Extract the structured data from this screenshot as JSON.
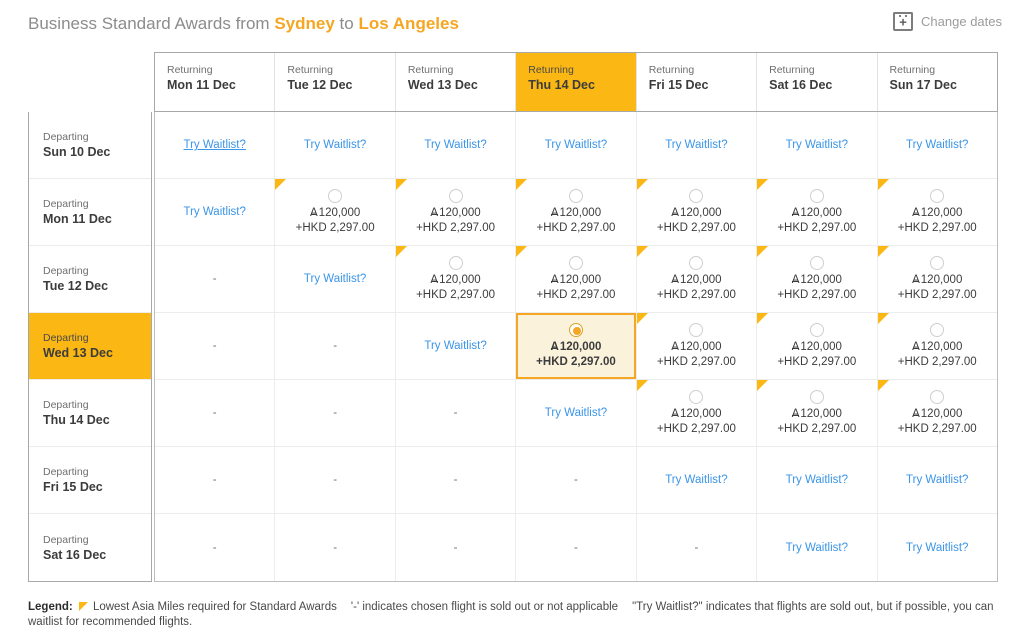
{
  "header": {
    "title_prefix": "Business Standard Awards from",
    "origin": "Sydney",
    "connector": "to",
    "destination": "Los Angeles",
    "change_dates_label": "Change dates",
    "calendar_icon": "calendar-plus-icon",
    "accent_color": "#f5a623",
    "highlight_color": "#fbb713"
  },
  "columns": {
    "label_prefix": "Returning",
    "dates": [
      "Mon 11 Dec",
      "Tue 12 Dec",
      "Wed 13 Dec",
      "Thu 14 Dec",
      "Fri 15 Dec",
      "Sat 16 Dec",
      "Sun 17 Dec"
    ],
    "selected_index": 3
  },
  "rows": {
    "label_prefix": "Departing",
    "dates": [
      "Sun 10 Dec",
      "Mon 11 Dec",
      "Tue 12 Dec",
      "Wed 13 Dec",
      "Thu 14 Dec",
      "Fri 15 Dec",
      "Sat 16 Dec"
    ],
    "selected_index": 3
  },
  "labels": {
    "waitlist": "Try Waitlist?",
    "dash": "-",
    "miles_symbol": "A",
    "miles_value": "120,000",
    "tax_value": "+HKD 2,297.00"
  },
  "cells": [
    [
      {
        "type": "waitlist",
        "hover": true
      },
      {
        "type": "waitlist"
      },
      {
        "type": "waitlist"
      },
      {
        "type": "waitlist"
      },
      {
        "type": "waitlist"
      },
      {
        "type": "waitlist"
      },
      {
        "type": "waitlist"
      }
    ],
    [
      {
        "type": "waitlist"
      },
      {
        "type": "price",
        "flag": true
      },
      {
        "type": "price",
        "flag": true
      },
      {
        "type": "price",
        "flag": true
      },
      {
        "type": "price",
        "flag": true
      },
      {
        "type": "price",
        "flag": true
      },
      {
        "type": "price",
        "flag": true
      }
    ],
    [
      {
        "type": "dash"
      },
      {
        "type": "waitlist"
      },
      {
        "type": "price",
        "flag": true
      },
      {
        "type": "price",
        "flag": true
      },
      {
        "type": "price",
        "flag": true
      },
      {
        "type": "price",
        "flag": true
      },
      {
        "type": "price",
        "flag": true
      }
    ],
    [
      {
        "type": "dash"
      },
      {
        "type": "dash"
      },
      {
        "type": "waitlist"
      },
      {
        "type": "price",
        "selected": true
      },
      {
        "type": "price",
        "flag": true
      },
      {
        "type": "price",
        "flag": true
      },
      {
        "type": "price",
        "flag": true
      }
    ],
    [
      {
        "type": "dash"
      },
      {
        "type": "dash"
      },
      {
        "type": "dash"
      },
      {
        "type": "waitlist"
      },
      {
        "type": "price",
        "flag": true
      },
      {
        "type": "price",
        "flag": true
      },
      {
        "type": "price",
        "flag": true
      }
    ],
    [
      {
        "type": "dash"
      },
      {
        "type": "dash"
      },
      {
        "type": "dash"
      },
      {
        "type": "dash"
      },
      {
        "type": "waitlist"
      },
      {
        "type": "waitlist"
      },
      {
        "type": "waitlist"
      }
    ],
    [
      {
        "type": "dash"
      },
      {
        "type": "dash"
      },
      {
        "type": "dash"
      },
      {
        "type": "dash"
      },
      {
        "type": "dash"
      },
      {
        "type": "waitlist"
      },
      {
        "type": "waitlist"
      }
    ]
  ],
  "legend": {
    "title": "Legend:",
    "flag_icon": "lowest-miles-flag-icon",
    "flag_text": "Lowest Asia Miles required for Standard Awards",
    "dash_text": "'-' indicates chosen flight is sold out or not applicable",
    "waitlist_text": "\"Try Waitlist?\" indicates that flights are sold out, but if possible, you can waitlist for recommended flights."
  }
}
